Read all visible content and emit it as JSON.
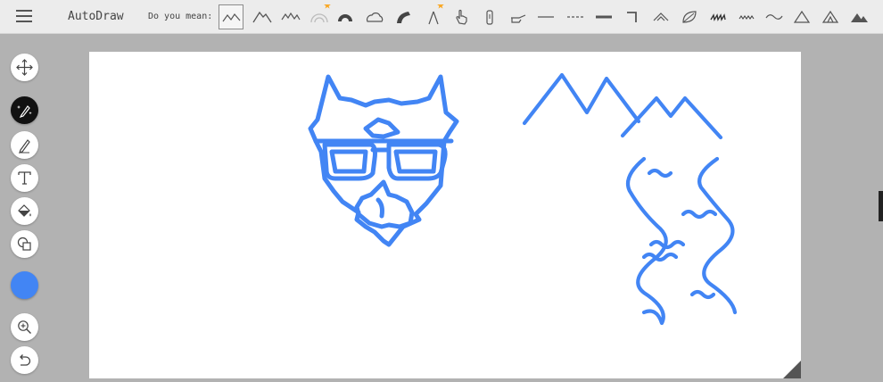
{
  "app": {
    "title": "AutoDraw",
    "suggest_label": "Do you mean:"
  },
  "suggestions": [
    {
      "name": "mountains-outline",
      "selected": true
    },
    {
      "name": "mountain-peaks"
    },
    {
      "name": "mountain-range"
    },
    {
      "name": "rainbow",
      "starred": true
    },
    {
      "name": "helmet"
    },
    {
      "name": "cloud"
    },
    {
      "name": "wave"
    },
    {
      "name": "wishbone",
      "starred": true
    },
    {
      "name": "hand-pointer"
    },
    {
      "name": "bottle"
    },
    {
      "name": "pointing-hand"
    },
    {
      "name": "line"
    },
    {
      "name": "dashed-line"
    },
    {
      "name": "thick-line"
    },
    {
      "name": "corner-line"
    },
    {
      "name": "chevron-shape"
    },
    {
      "name": "leaf"
    },
    {
      "name": "grass"
    },
    {
      "name": "zigzag"
    },
    {
      "name": "wave-line"
    },
    {
      "name": "tent"
    },
    {
      "name": "camp-tent"
    },
    {
      "name": "tent-group"
    }
  ],
  "tools": [
    {
      "name": "move-tool",
      "icon": "move-icon"
    },
    {
      "name": "autodraw-tool",
      "icon": "autodraw-icon",
      "active": true
    },
    {
      "name": "draw-tool",
      "icon": "pencil-icon"
    },
    {
      "name": "type-tool",
      "icon": "text-icon"
    },
    {
      "name": "fill-tool",
      "icon": "fill-bucket-icon"
    },
    {
      "name": "shape-tool",
      "icon": "shapes-icon"
    },
    {
      "name": "zoom-tool",
      "icon": "zoom-in-icon"
    },
    {
      "name": "undo-tool",
      "icon": "undo-icon"
    }
  ],
  "colors": {
    "accent": "#4285f4",
    "stroke": "#4285f4",
    "star": "#f9a825"
  }
}
